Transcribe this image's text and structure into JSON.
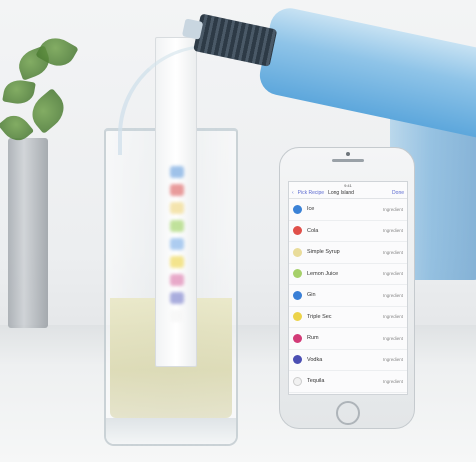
{
  "phone": {
    "status_time": "9:41",
    "nav": {
      "back_label": "Pick Recipe",
      "title": "Long Island",
      "done_label": "Done"
    },
    "ingredients": [
      {
        "name": "Ice",
        "type": "Ingredient",
        "dot_color": "#3b82d6",
        "dot_glyph": "●"
      },
      {
        "name": "Cola",
        "type": "Ingredient",
        "dot_color": "#e0504a",
        "dot_glyph": "●"
      },
      {
        "name": "Simple Syrup",
        "type": "Ingredient",
        "dot_color": "#e9dc9a",
        "dot_glyph": "●"
      },
      {
        "name": "Lemon Juice",
        "type": "Ingredient",
        "dot_color": "#a6d06a",
        "dot_glyph": "●"
      },
      {
        "name": "Gin",
        "type": "Ingredient",
        "dot_color": "#3a7fd6",
        "dot_glyph": "●"
      },
      {
        "name": "Triple Sec",
        "type": "Ingredient",
        "dot_color": "#ecd34a",
        "dot_glyph": "●"
      },
      {
        "name": "Rum",
        "type": "Ingredient",
        "dot_color": "#d23b77",
        "dot_glyph": "●"
      },
      {
        "name": "Vodka",
        "type": "Ingredient",
        "dot_color": "#4b4fb3",
        "dot_glyph": "●"
      },
      {
        "name": "Tequila",
        "type": "Ingredient",
        "dot_color": "#f1f1f1",
        "dot_glyph": "●"
      }
    ]
  },
  "stick_leds": [
    "#8fb8e6",
    "#e58a8a",
    "#f3e0a0",
    "#b6dd8a",
    "#9fc4ee",
    "#f2e07a",
    "#e49ac0",
    "#9b9fd8",
    "#f7f7f7"
  ]
}
